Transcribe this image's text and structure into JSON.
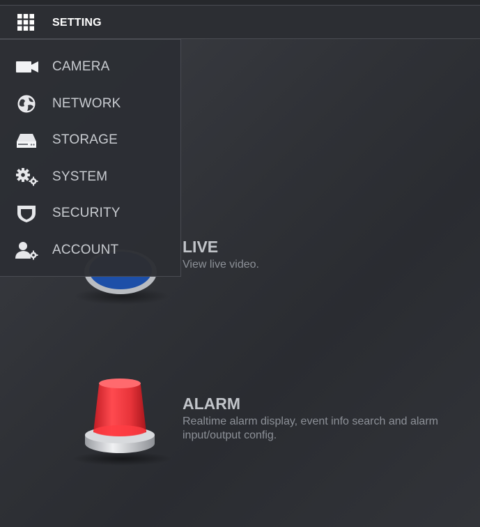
{
  "header": {
    "title": "SETTING",
    "grid_icon": "grid-icon"
  },
  "menu": {
    "items": [
      {
        "label": "CAMERA",
        "icon": "camera-icon"
      },
      {
        "label": "NETWORK",
        "icon": "network-icon"
      },
      {
        "label": "STORAGE",
        "icon": "storage-icon"
      },
      {
        "label": "SYSTEM",
        "icon": "gears-icon"
      },
      {
        "label": "SECURITY",
        "icon": "shield-icon"
      },
      {
        "label": "ACCOUNT",
        "icon": "user-gear-icon"
      }
    ]
  },
  "tiles": [
    {
      "title": "LIVE",
      "description": "View live video.",
      "icon": "live-icon"
    },
    {
      "title": "ALARM",
      "description": "Realtime alarm display, event info search and alarm input/output config.",
      "icon": "alarm-siren-icon"
    }
  ],
  "colors": {
    "background": "#2f3136",
    "menu_background": "#2c2e34",
    "alarm_red": "#e8343a",
    "live_blue": "#1d4fa8"
  }
}
